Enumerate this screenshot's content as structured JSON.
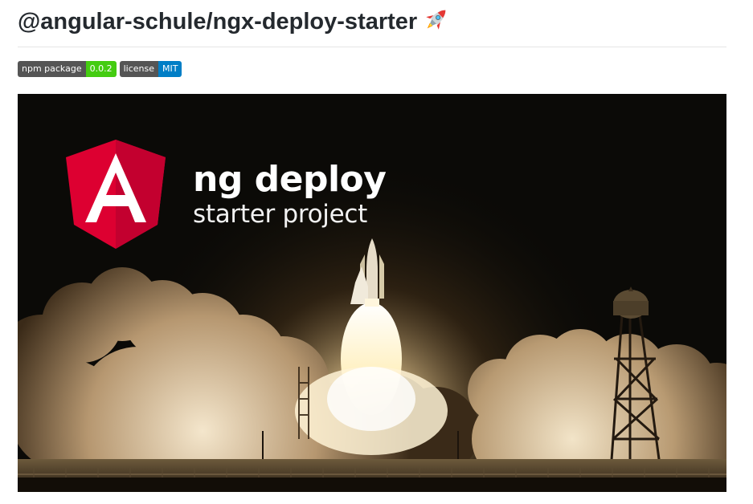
{
  "readme": {
    "title": "@angular-schule/ngx-deploy-starter",
    "title_emoji": "rocket-icon"
  },
  "badges": [
    {
      "label": "npm package",
      "value": "0.0.2",
      "color": "#44cc11"
    },
    {
      "label": "license",
      "value": "MIT",
      "color": "#007ec6"
    }
  ],
  "hero": {
    "logo": "angular-logo",
    "logo_letter": "A",
    "title": "ng deploy",
    "subtitle": "starter project",
    "scene": "space-shuttle-launch-night"
  },
  "colors": {
    "angular_red": "#dd0031",
    "angular_dark_red": "#c3002f",
    "hero_background": "#0b0a07",
    "smoke": "#e8d9bf"
  }
}
